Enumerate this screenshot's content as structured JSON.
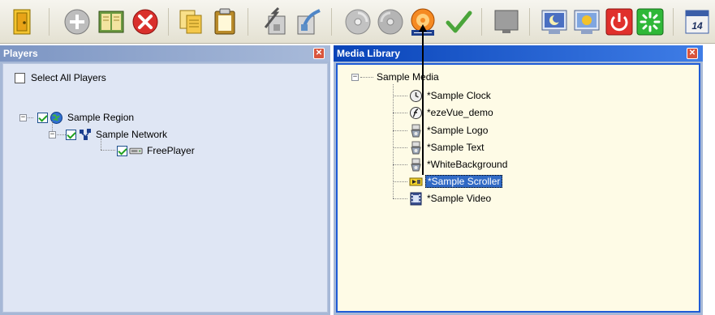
{
  "toolbar": {
    "buttons": [
      {
        "name": "exit-door-icon",
        "color": "#e8a317"
      },
      {
        "name": "add-icon",
        "color": "#8e8e8e"
      },
      {
        "name": "open-book-icon",
        "color": "#3a7a2e"
      },
      {
        "name": "delete-icon",
        "color": "#d9302c"
      },
      {
        "name": "copy-icon",
        "color": "#d4a017"
      },
      {
        "name": "paste-icon",
        "color": "#b98b2a"
      },
      {
        "name": "import-icon",
        "color": "#7f7f7f"
      },
      {
        "name": "export-icon",
        "color": "#5d8fc7"
      },
      {
        "name": "disc-icon",
        "color": "#9b9b9b"
      },
      {
        "name": "disc-alt-icon",
        "color": "#9b9b9b"
      },
      {
        "name": "publish-icon",
        "color": "#f27b1a"
      },
      {
        "name": "checkmark-icon",
        "color": "#4aa53a"
      },
      {
        "name": "monitor-off-icon",
        "color": "#8d8d8d"
      },
      {
        "name": "night-screen-icon",
        "color": "#4a6fc2"
      },
      {
        "name": "day-screen-icon",
        "color": "#f2c22b"
      },
      {
        "name": "power-icon",
        "color": "#e0302c"
      },
      {
        "name": "refresh-icon",
        "color": "#2fb838"
      },
      {
        "name": "calendar-icon",
        "color": "#3b5ea8"
      }
    ],
    "calendar_day": "14"
  },
  "players_panel": {
    "title": "Players",
    "select_all_label": "Select All Players",
    "region_label": "Sample Region",
    "network_label": "Sample Network",
    "player_label": "FreePlayer"
  },
  "media_panel": {
    "title": "Media Library",
    "root_label": "Sample Media",
    "items": [
      {
        "label": "*Sample Clock",
        "icon": "clock-icon",
        "selected": false
      },
      {
        "label": "*ezeVue_demo",
        "icon": "flash-icon",
        "selected": false
      },
      {
        "label": "*Sample Logo",
        "icon": "image-icon",
        "selected": false
      },
      {
        "label": "*Sample Text",
        "icon": "text-media-icon",
        "selected": false
      },
      {
        "label": "*WhiteBackground",
        "icon": "background-icon",
        "selected": false
      },
      {
        "label": "*Sample Scroller",
        "icon": "scroller-icon",
        "selected": true
      },
      {
        "label": "*Sample Video",
        "icon": "video-icon",
        "selected": false
      }
    ]
  },
  "colors": {
    "selection": "#316ac5",
    "media_title_bar": "#0843b8",
    "players_title_bar": "#7c95c3",
    "media_background": "#fefbe6",
    "players_background": "#dfe6f4"
  }
}
